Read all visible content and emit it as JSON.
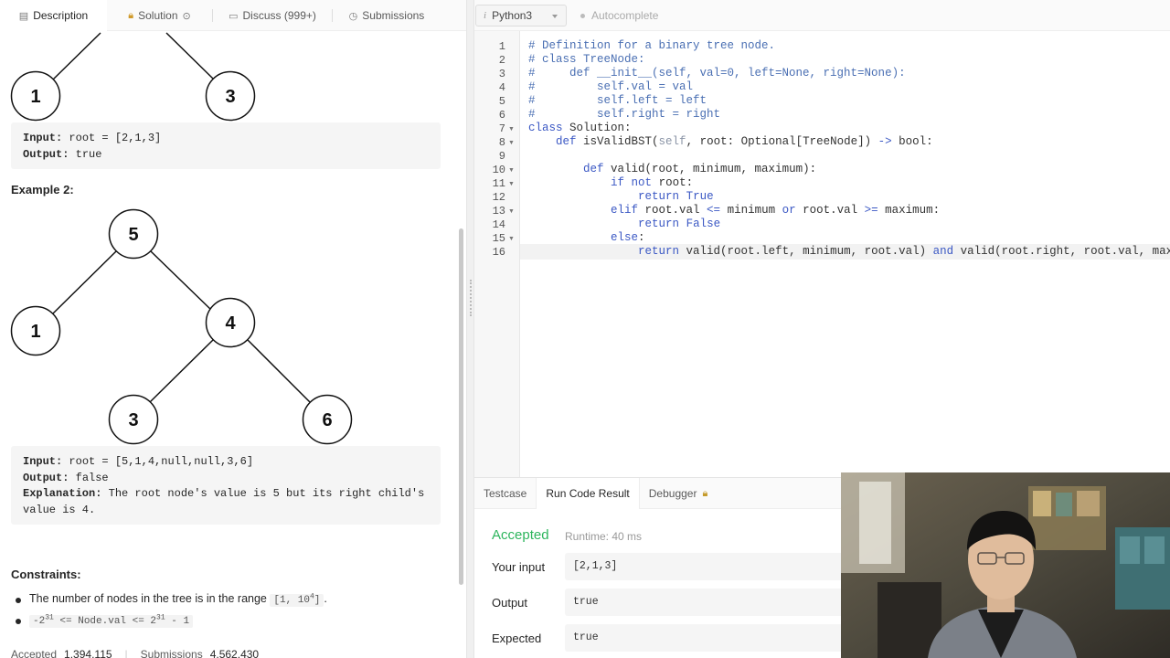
{
  "left_tabs": [
    {
      "label": "Description",
      "icon": "description-icon"
    },
    {
      "label": "Solution",
      "icon": "lock-icon"
    },
    {
      "label": "Discuss (999+)",
      "icon": "discuss-icon"
    },
    {
      "label": "Submissions",
      "icon": "history-icon"
    }
  ],
  "example1": {
    "nodes": [
      "1",
      "3"
    ],
    "input_label": "Input:",
    "input_value": "root = [2,1,3]",
    "output_label": "Output:",
    "output_value": "true"
  },
  "example2": {
    "heading": "Example 2:",
    "nodes": [
      "5",
      "1",
      "4",
      "3",
      "6"
    ],
    "input_label": "Input:",
    "input_value": "root = [5,1,4,null,null,3,6]",
    "output_label": "Output:",
    "output_value": "false",
    "explanation_label": "Explanation:",
    "explanation_line1": "The root node's value is 5 but its right child's",
    "explanation_line2": "value is 4."
  },
  "constraints": {
    "heading": "Constraints:",
    "item1_text": "The number of nodes in the tree is in the range",
    "item1_range_a": "[1, 10",
    "item1_range_sup": "4",
    "item1_range_b": "]",
    "item1_end": ".",
    "item2_a": "-2",
    "item2_sup1": "31",
    "item2_b": " <= Node.val <= 2",
    "item2_sup2": "31",
    "item2_c": " - 1"
  },
  "stats": {
    "accepted_label": "Accepted",
    "accepted_value": "1,394,115",
    "submissions_label": "Submissions",
    "submissions_value": "4,562,430"
  },
  "editor": {
    "language": "Python3",
    "autocomplete_label": "Autocomplete",
    "line_numbers": [
      "1",
      "2",
      "3",
      "4",
      "5",
      "6",
      "7",
      "8",
      "9",
      "10",
      "11",
      "12",
      "13",
      "14",
      "15",
      "16"
    ]
  },
  "result": {
    "tabs": [
      "Testcase",
      "Run Code Result",
      "Debugger"
    ],
    "status": "Accepted",
    "runtime": "Runtime: 40 ms",
    "your_input_label": "Your input",
    "your_input_value": "[2,1,3]",
    "output_label": "Output",
    "output_value": "true",
    "expected_label": "Expected",
    "expected_value": "true"
  },
  "colors": {
    "accepted_green": "#2db55d",
    "keyword_blue": "#3b58c4",
    "comment_blue": "#4a6fb3"
  }
}
